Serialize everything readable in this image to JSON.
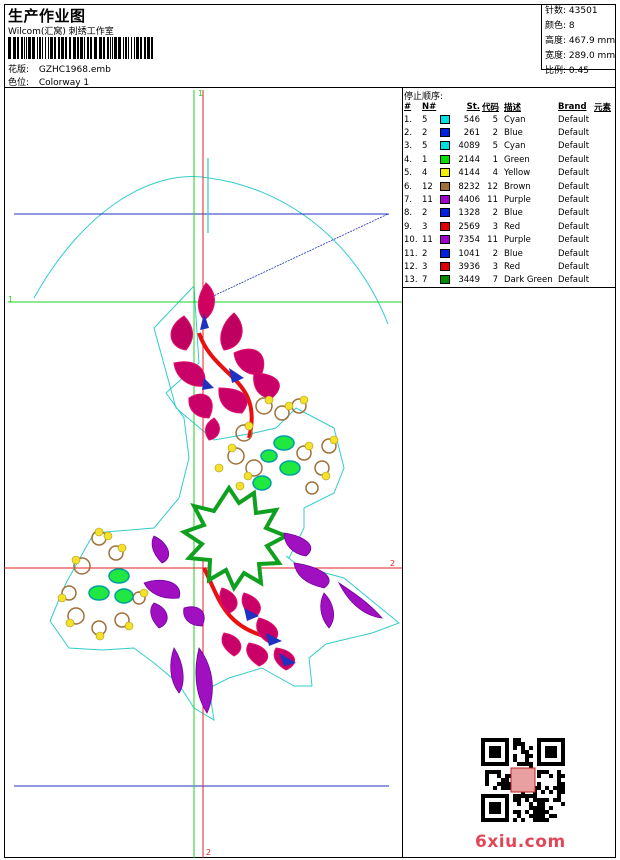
{
  "header": {
    "title": "生产作业图",
    "studio": "Wilcom(汇窝) 刺绣工作室",
    "design_label": "花版:",
    "design_value": "GZHC1968.emb",
    "colorway_label": "色位:",
    "colorway_value": "Colorway 1"
  },
  "stats": [
    {
      "label": "针数:",
      "value": "43501"
    },
    {
      "label": "颜色:",
      "value": "8"
    },
    {
      "label": "高度:",
      "value": "467.9 mm"
    },
    {
      "label": "宽度:",
      "value": "289.0 mm"
    },
    {
      "label": "比例:",
      "value": "0.45"
    }
  ],
  "stop_sequence": {
    "title": "停止顺序:",
    "headers": {
      "hash": "#",
      "n": "N#",
      "stitches": "St.",
      "code": "代码",
      "desc": "描述",
      "brand": "Brand",
      "elem": "元素"
    },
    "rows": [
      {
        "idx": "1.",
        "n": "5",
        "color": "#00e0e0",
        "st": "546",
        "code": "5",
        "desc": "Cyan",
        "brand": "Default"
      },
      {
        "idx": "2.",
        "n": "2",
        "color": "#0020e0",
        "st": "261",
        "code": "2",
        "desc": "Blue",
        "brand": "Default"
      },
      {
        "idx": "3.",
        "n": "5",
        "color": "#00e0e0",
        "st": "4089",
        "code": "5",
        "desc": "Cyan",
        "brand": "Default"
      },
      {
        "idx": "4.",
        "n": "1",
        "color": "#00e000",
        "st": "2144",
        "code": "1",
        "desc": "Green",
        "brand": "Default"
      },
      {
        "idx": "5.",
        "n": "4",
        "color": "#f0f000",
        "st": "4144",
        "code": "4",
        "desc": "Yellow",
        "brand": "Default"
      },
      {
        "idx": "6.",
        "n": "12",
        "color": "#a0703a",
        "st": "8232",
        "code": "12",
        "desc": "Brown",
        "brand": "Default"
      },
      {
        "idx": "7.",
        "n": "11",
        "color": "#a000d0",
        "st": "4406",
        "code": "11",
        "desc": "Purple",
        "brand": "Default"
      },
      {
        "idx": "8.",
        "n": "2",
        "color": "#0020e0",
        "st": "1328",
        "code": "2",
        "desc": "Blue",
        "brand": "Default"
      },
      {
        "idx": "9.",
        "n": "3",
        "color": "#e00000",
        "st": "2569",
        "code": "3",
        "desc": "Red",
        "brand": "Default"
      },
      {
        "idx": "10.",
        "n": "11",
        "color": "#a000d0",
        "st": "7354",
        "code": "11",
        "desc": "Purple",
        "brand": "Default"
      },
      {
        "idx": "11.",
        "n": "2",
        "color": "#0020e0",
        "st": "1041",
        "code": "2",
        "desc": "Blue",
        "brand": "Default"
      },
      {
        "idx": "12.",
        "n": "3",
        "color": "#e00000",
        "st": "3936",
        "code": "3",
        "desc": "Red",
        "brand": "Default"
      },
      {
        "idx": "13.",
        "n": "7",
        "color": "#008a00",
        "st": "3449",
        "code": "7",
        "desc": "Dark Green",
        "brand": "Default"
      }
    ]
  },
  "guides": {
    "top_label": "1",
    "left_label": "1",
    "right_label": "2",
    "bottom_label": "2"
  },
  "watermark": "6xiu.com",
  "icons": {
    "barcode": "barcode-icon",
    "qr": "qr-code-icon",
    "stamp": "seal-stamp"
  }
}
